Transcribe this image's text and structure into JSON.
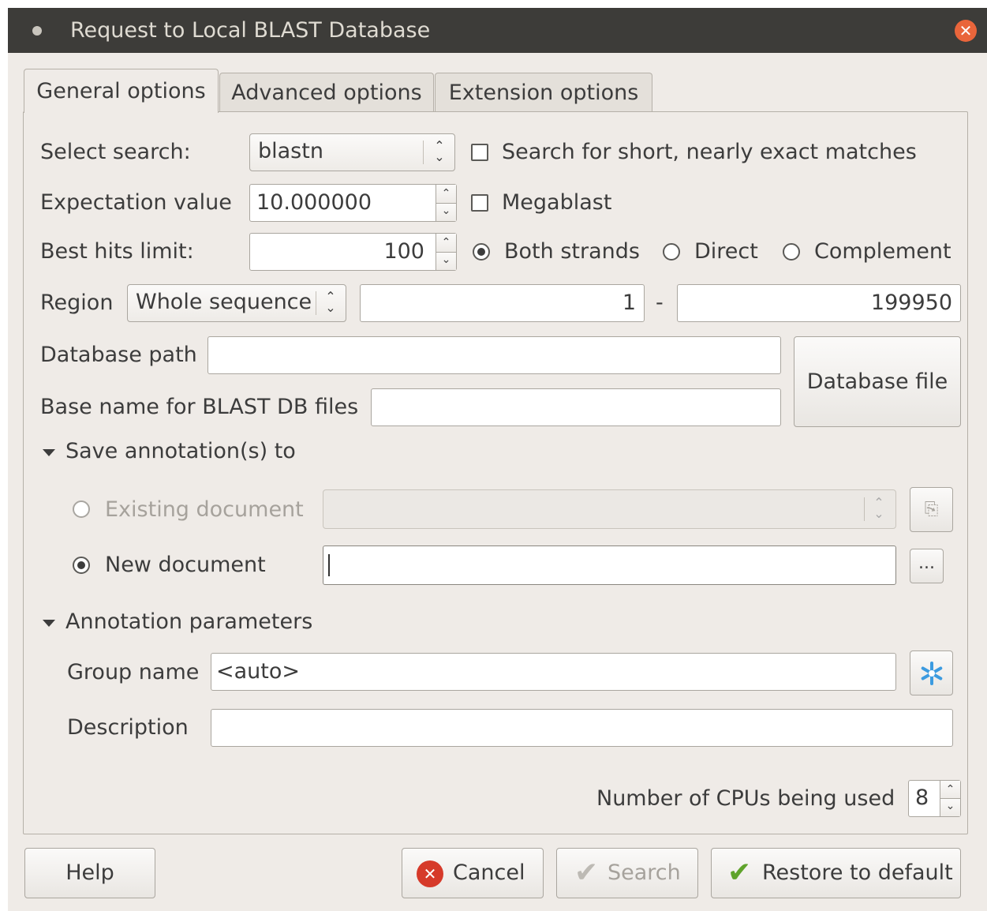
{
  "window": {
    "title": "Request to Local BLAST Database",
    "close_symbol": "✕"
  },
  "tabs": [
    {
      "label": "General options",
      "active": true
    },
    {
      "label": "Advanced options",
      "active": false
    },
    {
      "label": "Extension options",
      "active": false
    }
  ],
  "general": {
    "select_search": {
      "label": "Select search:",
      "value": "blastn"
    },
    "short_matches": {
      "label": "Search for short, nearly exact matches",
      "checked": false
    },
    "expectation": {
      "label": "Expectation value",
      "value": "10.000000"
    },
    "megablast": {
      "label": "Megablast",
      "checked": false
    },
    "best_hits": {
      "label": "Best hits limit:",
      "value": "100"
    },
    "strands": {
      "options": [
        "Both strands",
        "Direct",
        "Complement"
      ],
      "selected": "Both strands"
    },
    "region": {
      "label": "Region",
      "mode": "Whole sequence",
      "from": "1",
      "separator": "-",
      "to": "199950"
    },
    "database_path": {
      "label": "Database path",
      "value": ""
    },
    "base_name": {
      "label": "Base name for BLAST DB files",
      "value": ""
    },
    "database_file_button": "Database file"
  },
  "save_annotations": {
    "header": "Save annotation(s) to",
    "existing_document": {
      "label": "Existing document",
      "value": "",
      "enabled": false
    },
    "new_document": {
      "label": "New document",
      "value": "",
      "browse_label": "..."
    }
  },
  "annotation_params": {
    "header": "Annotation parameters",
    "group_name": {
      "label": "Group name",
      "value": "<auto>"
    },
    "description": {
      "label": "Description",
      "value": ""
    }
  },
  "cpus": {
    "label": "Number of CPUs being used",
    "value": "8"
  },
  "buttons": {
    "help": "Help",
    "cancel": "Cancel",
    "search": "Search",
    "restore": "Restore to default"
  },
  "colors": {
    "titlebar": "#3d3c39",
    "dialog_bg": "#efebe7",
    "close": "#e9653b",
    "cancel_icon": "#d63a2a",
    "check_icon": "#5fa32b",
    "asterisk_icon": "#3c9be0"
  }
}
